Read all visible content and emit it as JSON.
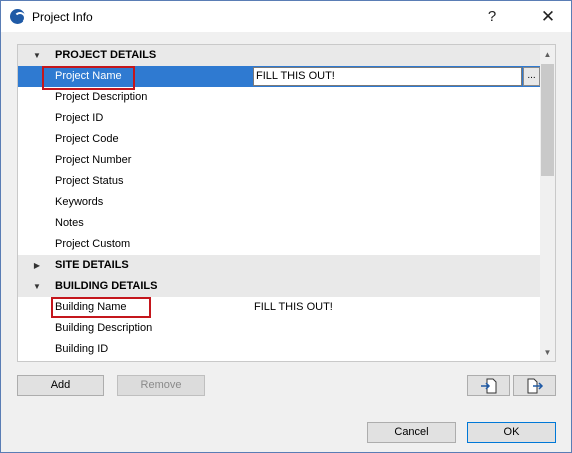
{
  "window": {
    "title": "Project Info",
    "help_glyph": "?",
    "close_glyph": "✕"
  },
  "tree": {
    "groups": [
      {
        "label": "PROJECT DETAILS",
        "expanded": true,
        "items": [
          {
            "label": "Project Name",
            "value": "FILL THIS OUT!",
            "selected": true
          },
          {
            "label": "Project Description",
            "value": ""
          },
          {
            "label": "Project ID",
            "value": ""
          },
          {
            "label": "Project Code",
            "value": ""
          },
          {
            "label": "Project Number",
            "value": ""
          },
          {
            "label": "Project Status",
            "value": ""
          },
          {
            "label": "Keywords",
            "value": ""
          },
          {
            "label": "Notes",
            "value": ""
          },
          {
            "label": "Project Custom",
            "value": ""
          }
        ]
      },
      {
        "label": "SITE DETAILS",
        "expanded": false,
        "items": []
      },
      {
        "label": "BUILDING DETAILS",
        "expanded": true,
        "items": [
          {
            "label": "Building Name",
            "value": "FILL THIS OUT!"
          },
          {
            "label": "Building Description",
            "value": ""
          },
          {
            "label": "Building ID",
            "value": ""
          }
        ]
      }
    ],
    "more_button": "...",
    "expanded_glyph": "▼",
    "collapsed_glyph": "▶"
  },
  "scrollbar": {
    "up_glyph": "▲",
    "down_glyph": "▼"
  },
  "buttons": {
    "add": "Add",
    "remove": "Remove",
    "cancel": "Cancel",
    "ok": "OK"
  },
  "colors": {
    "selection": "#2f7ad1",
    "highlight_box": "#c4161c",
    "group_band": "#e9e9e9"
  }
}
